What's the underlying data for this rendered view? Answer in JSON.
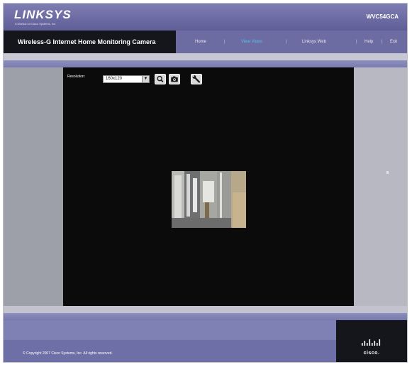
{
  "header": {
    "logo": "LINKSYS",
    "logo_sub": "A Division of Cisco Systems, Inc.",
    "model": "WVC54GCA"
  },
  "nav": {
    "product_title": "Wireless-G Internet Home Monitoring Camera",
    "items": [
      {
        "label": "Home",
        "active": false
      },
      {
        "label": "View Video",
        "active": true
      },
      {
        "label": "Linksys Web",
        "active": false
      },
      {
        "label": "Help",
        "active": false
      },
      {
        "label": "Exit",
        "active": false
      }
    ],
    "separator": "|"
  },
  "viewer": {
    "resolution_label": "Resolution:",
    "resolution_value": "160x120",
    "icons": [
      "zoom-icon",
      "snapshot-icon",
      "settings-wrench-icon"
    ]
  },
  "footer": {
    "copyright": "© Copyright 2007 Cisco Systems, Inc. All rights reserved.",
    "cisco_wordmark": "cisco."
  },
  "colors": {
    "header_purple": "#6c6ba3",
    "nav_dark": "#15151c",
    "active_link": "#56c0ee",
    "viewer_black": "#0b0b0b"
  }
}
